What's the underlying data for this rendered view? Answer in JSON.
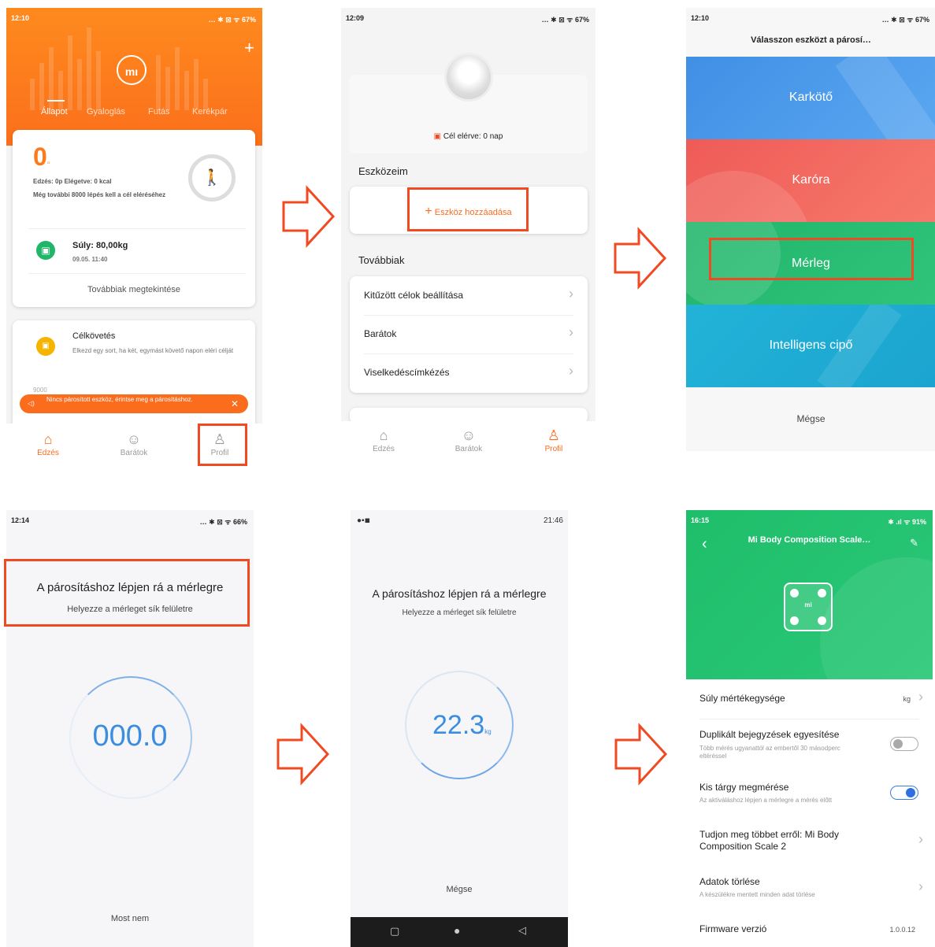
{
  "s1": {
    "time": "12:10",
    "status_right": "… ✱ ⊠ ᯤ 67%",
    "tabs": [
      "Állapot",
      "Gyaloglás",
      "Futás",
      "Kerékpár"
    ],
    "steps": "0",
    "steps_unit": "▫",
    "exercise": "Edzés: 0p Elégetve: 0 kcal",
    "remaining": "Még további 8000 lépés kell a cél eléréséhez",
    "weight_title": "Súly: 80,00kg",
    "weight_date": "09.05. 11:40",
    "more": "Továbbiak megtekintése",
    "goal_title": "Célkövetés",
    "goal_text": "Elkezd egy sort, ha két, egymást követő napon eléri célját",
    "axis_value": "9000",
    "toast": "Nincs párosított eszköz, érintse meg a párosításhoz.",
    "nav": [
      "Edzés",
      "Barátok",
      "Profil"
    ]
  },
  "s2": {
    "time": "12:09",
    "status_right": "… ✱ ⊠ ᯤ 67%",
    "goal_reached": "Cél elérve: 0 nap",
    "my_devices": "Eszközeim",
    "add_device": "Eszköz hozzáadása",
    "more_title": "Továbbiak",
    "menu": [
      "Kitűzött célok beállítása",
      "Barátok",
      "Viselkedéscímkézés"
    ],
    "nav": [
      "Edzés",
      "Barátok",
      "Profil"
    ]
  },
  "s3": {
    "time": "12:10",
    "status_right": "… ✱ ⊠ ᯤ 67%",
    "title": "Válasszon eszközt a párosí…",
    "options": [
      "Karkötő",
      "Karóra",
      "Mérleg",
      "Intelligens cipő"
    ],
    "cancel": "Mégse"
  },
  "s4": {
    "time": "12:14",
    "status_right": "… ✱ ⊠ ᯤ 66%",
    "title": "A párosításhoz lépjen rá a mérlegre",
    "subtitle": "Helyezze a mérleget sík felületre",
    "reading": "000.0",
    "not_now": "Most nem"
  },
  "s5": {
    "time": "21:46",
    "title": "A párosításhoz lépjen rá a mérlegre",
    "subtitle": "Helyezze a mérleget sík felületre",
    "reading": "22.3",
    "unit": "kg",
    "cancel": "Mégse"
  },
  "s6": {
    "time": "16:15",
    "status_right": "✱ .ıl ᯤ 91%",
    "title": "Mi Body Composition Scale…",
    "logo": "mi",
    "rows": [
      {
        "label": "Súly mértékegysége",
        "value": "kg"
      },
      {
        "label": "Duplikált bejegyzések egyesítése",
        "sub": "Több mérés ugyanattól az embertől 30 másodperc eltéréssel"
      },
      {
        "label": "Kis tárgy megmérése",
        "sub": "Az aktiváláshoz lépjen a mérlegre a mérés előtt"
      },
      {
        "label": "Tudjon meg többet erről: Mi Body Composition Scale 2"
      },
      {
        "label": "Adatok törlése",
        "sub": "A készülékre mentett minden adat törlése"
      },
      {
        "label": "Firmware verzió",
        "value": "1.0.0.12"
      }
    ]
  },
  "colors": {
    "orange": "#fb7a1d",
    "red_highlight": "#f04a23",
    "blue_band": "#3f8fe6",
    "red_band": "#ef5b57",
    "green_band": "#21b56a",
    "cyan_band": "#22b3d8",
    "teal_header": "#1fbe6b",
    "scale_blue": "#3b8de0"
  }
}
